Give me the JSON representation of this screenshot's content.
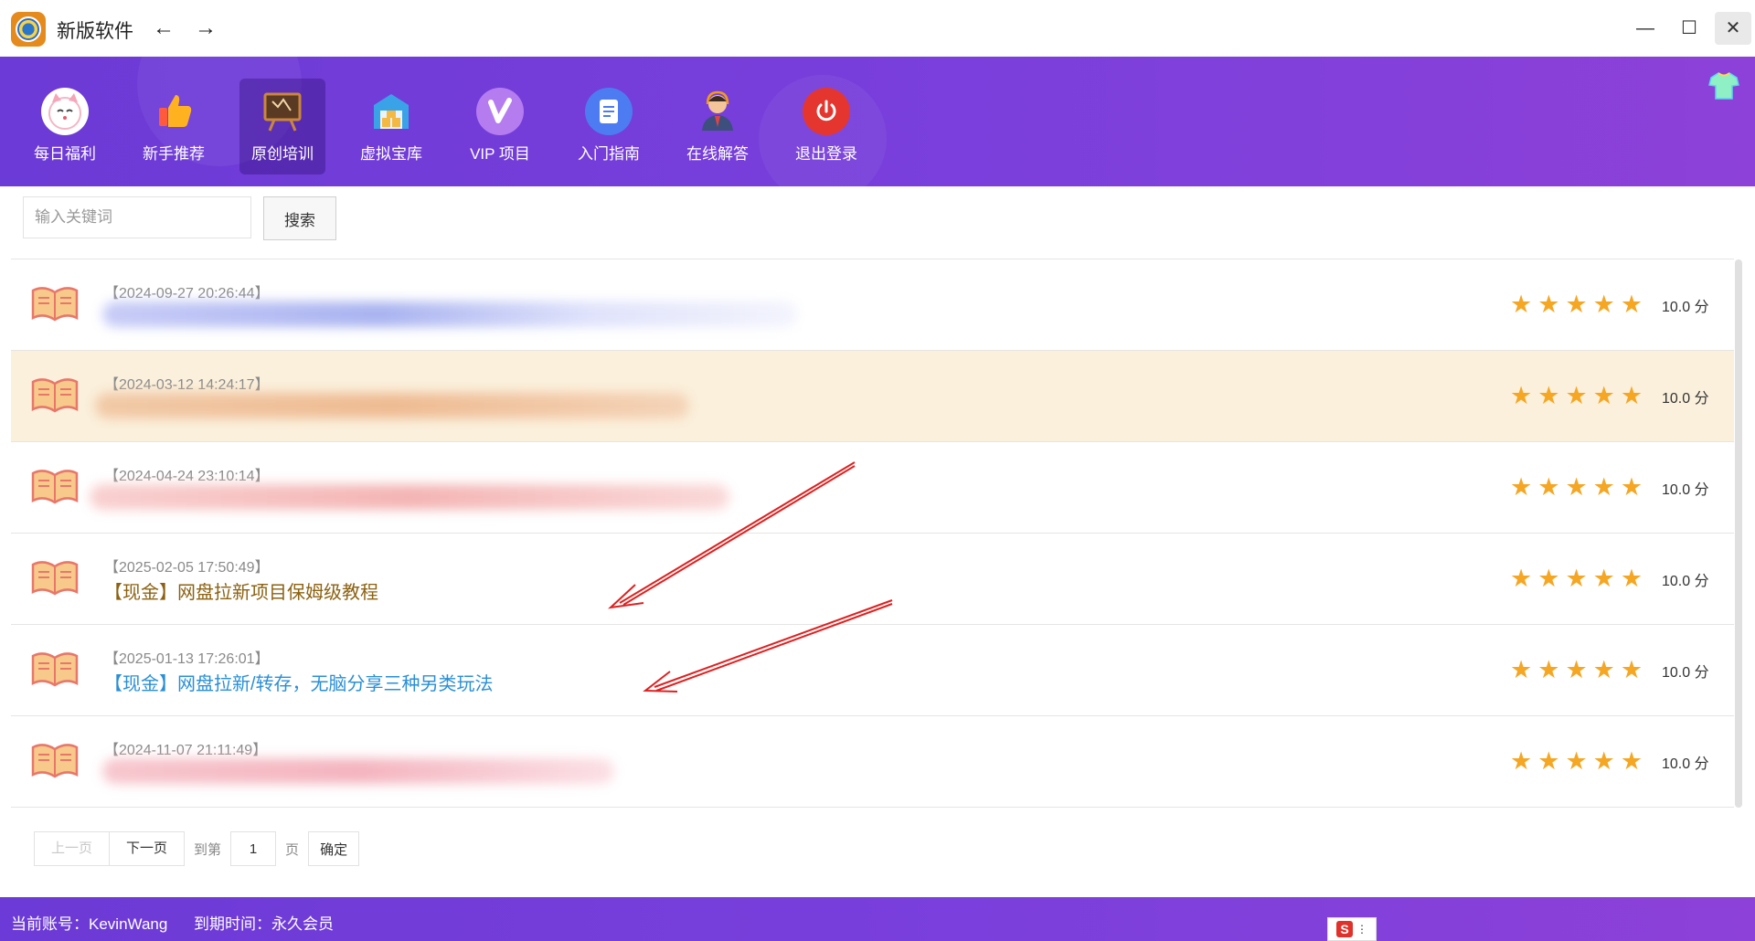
{
  "app": {
    "title": "新版软件",
    "back_icon": "←",
    "forward_icon": "→",
    "minimize_icon": "—",
    "maximize_icon": "☐",
    "close_icon": "✕"
  },
  "toolbar": {
    "items": [
      {
        "label": "每日福利",
        "icon": "lucky-cat-icon"
      },
      {
        "label": "新手推荐",
        "icon": "thumbs-up-icon"
      },
      {
        "label": "原创培训",
        "icon": "chalkboard-icon",
        "active": true
      },
      {
        "label": "虚拟宝库",
        "icon": "warehouse-icon"
      },
      {
        "label": "VIP 项目",
        "icon": "vip-icon"
      },
      {
        "label": "入门指南",
        "icon": "document-icon"
      },
      {
        "label": "在线解答",
        "icon": "support-agent-icon"
      },
      {
        "label": "退出登录",
        "icon": "power-icon"
      }
    ],
    "skin_icon": "tshirt-icon"
  },
  "search": {
    "placeholder": "输入关键词",
    "button_label": "搜索"
  },
  "list": {
    "rows": [
      {
        "date": "【2024-09-27 20:26:44】",
        "title": "",
        "score": "10.0 分"
      },
      {
        "date": "【2024-03-12 14:24:17】",
        "title": "",
        "score": "10.0 分"
      },
      {
        "date": "【2024-04-24 23:10:14】",
        "title": "",
        "score": "10.0 分"
      },
      {
        "date": "【2025-02-05 17:50:49】",
        "title": "【现金】网盘拉新项目保姆级教程",
        "score": "10.0 分"
      },
      {
        "date": "【2025-01-13 17:26:01】",
        "title": "【现金】网盘拉新/转存，无脑分享三种另类玩法",
        "score": "10.0 分"
      },
      {
        "date": "【2024-11-07 21:11:49】",
        "title": "",
        "score": "10.0 分"
      }
    ],
    "rating_stars": 5,
    "star_glyph": "★"
  },
  "pagination": {
    "prev_label": "上一页",
    "next_label": "下一页",
    "goto_label": "到第",
    "page_value": "1",
    "page_unit": "页",
    "confirm_label": "确定"
  },
  "status": {
    "account": "当前账号：KevinWang",
    "expiry": "到期时间：永久会员"
  },
  "ime": {
    "label": "S",
    "dots": "⋮"
  },
  "colors": {
    "toolbar_purple": "#7a3fdc",
    "star_orange": "#f5a623",
    "highlight_row": "#fbf0dc",
    "title_gold": "#8b6212",
    "title_blue": "#2a8fd6",
    "annotation_red": "#e02020"
  }
}
